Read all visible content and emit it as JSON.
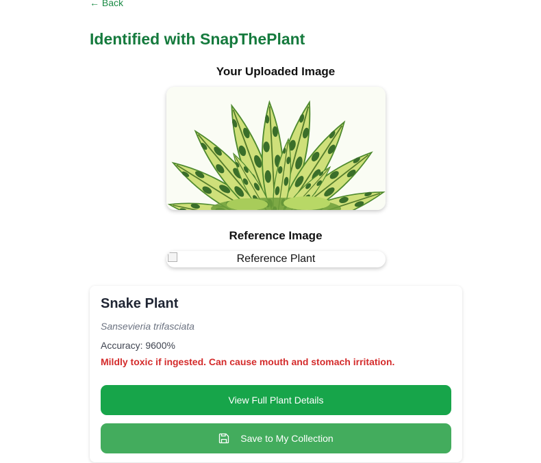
{
  "nav": {
    "back_label": "← Back"
  },
  "page": {
    "title": "Identified with SnapThePlant"
  },
  "uploaded": {
    "heading": "Your Uploaded Image"
  },
  "reference": {
    "heading": "Reference Image",
    "alt_text": "Reference Plant"
  },
  "result": {
    "common_name": "Snake Plant",
    "scientific_name": "Sansevieria trifasciata",
    "accuracy": "Accuracy: 9600%",
    "toxicity": "Mildly toxic if ingested. Can cause mouth and stomach irritation."
  },
  "actions": {
    "details_label": "View Full Plant Details",
    "save_label": "Save to My Collection",
    "save_icon": "floppy-disk-icon"
  },
  "colors": {
    "brand_green": "#157a3d",
    "primary_button": "#17a54a",
    "secondary_button": "#43ac5d",
    "warning_red": "#d42b2b"
  }
}
